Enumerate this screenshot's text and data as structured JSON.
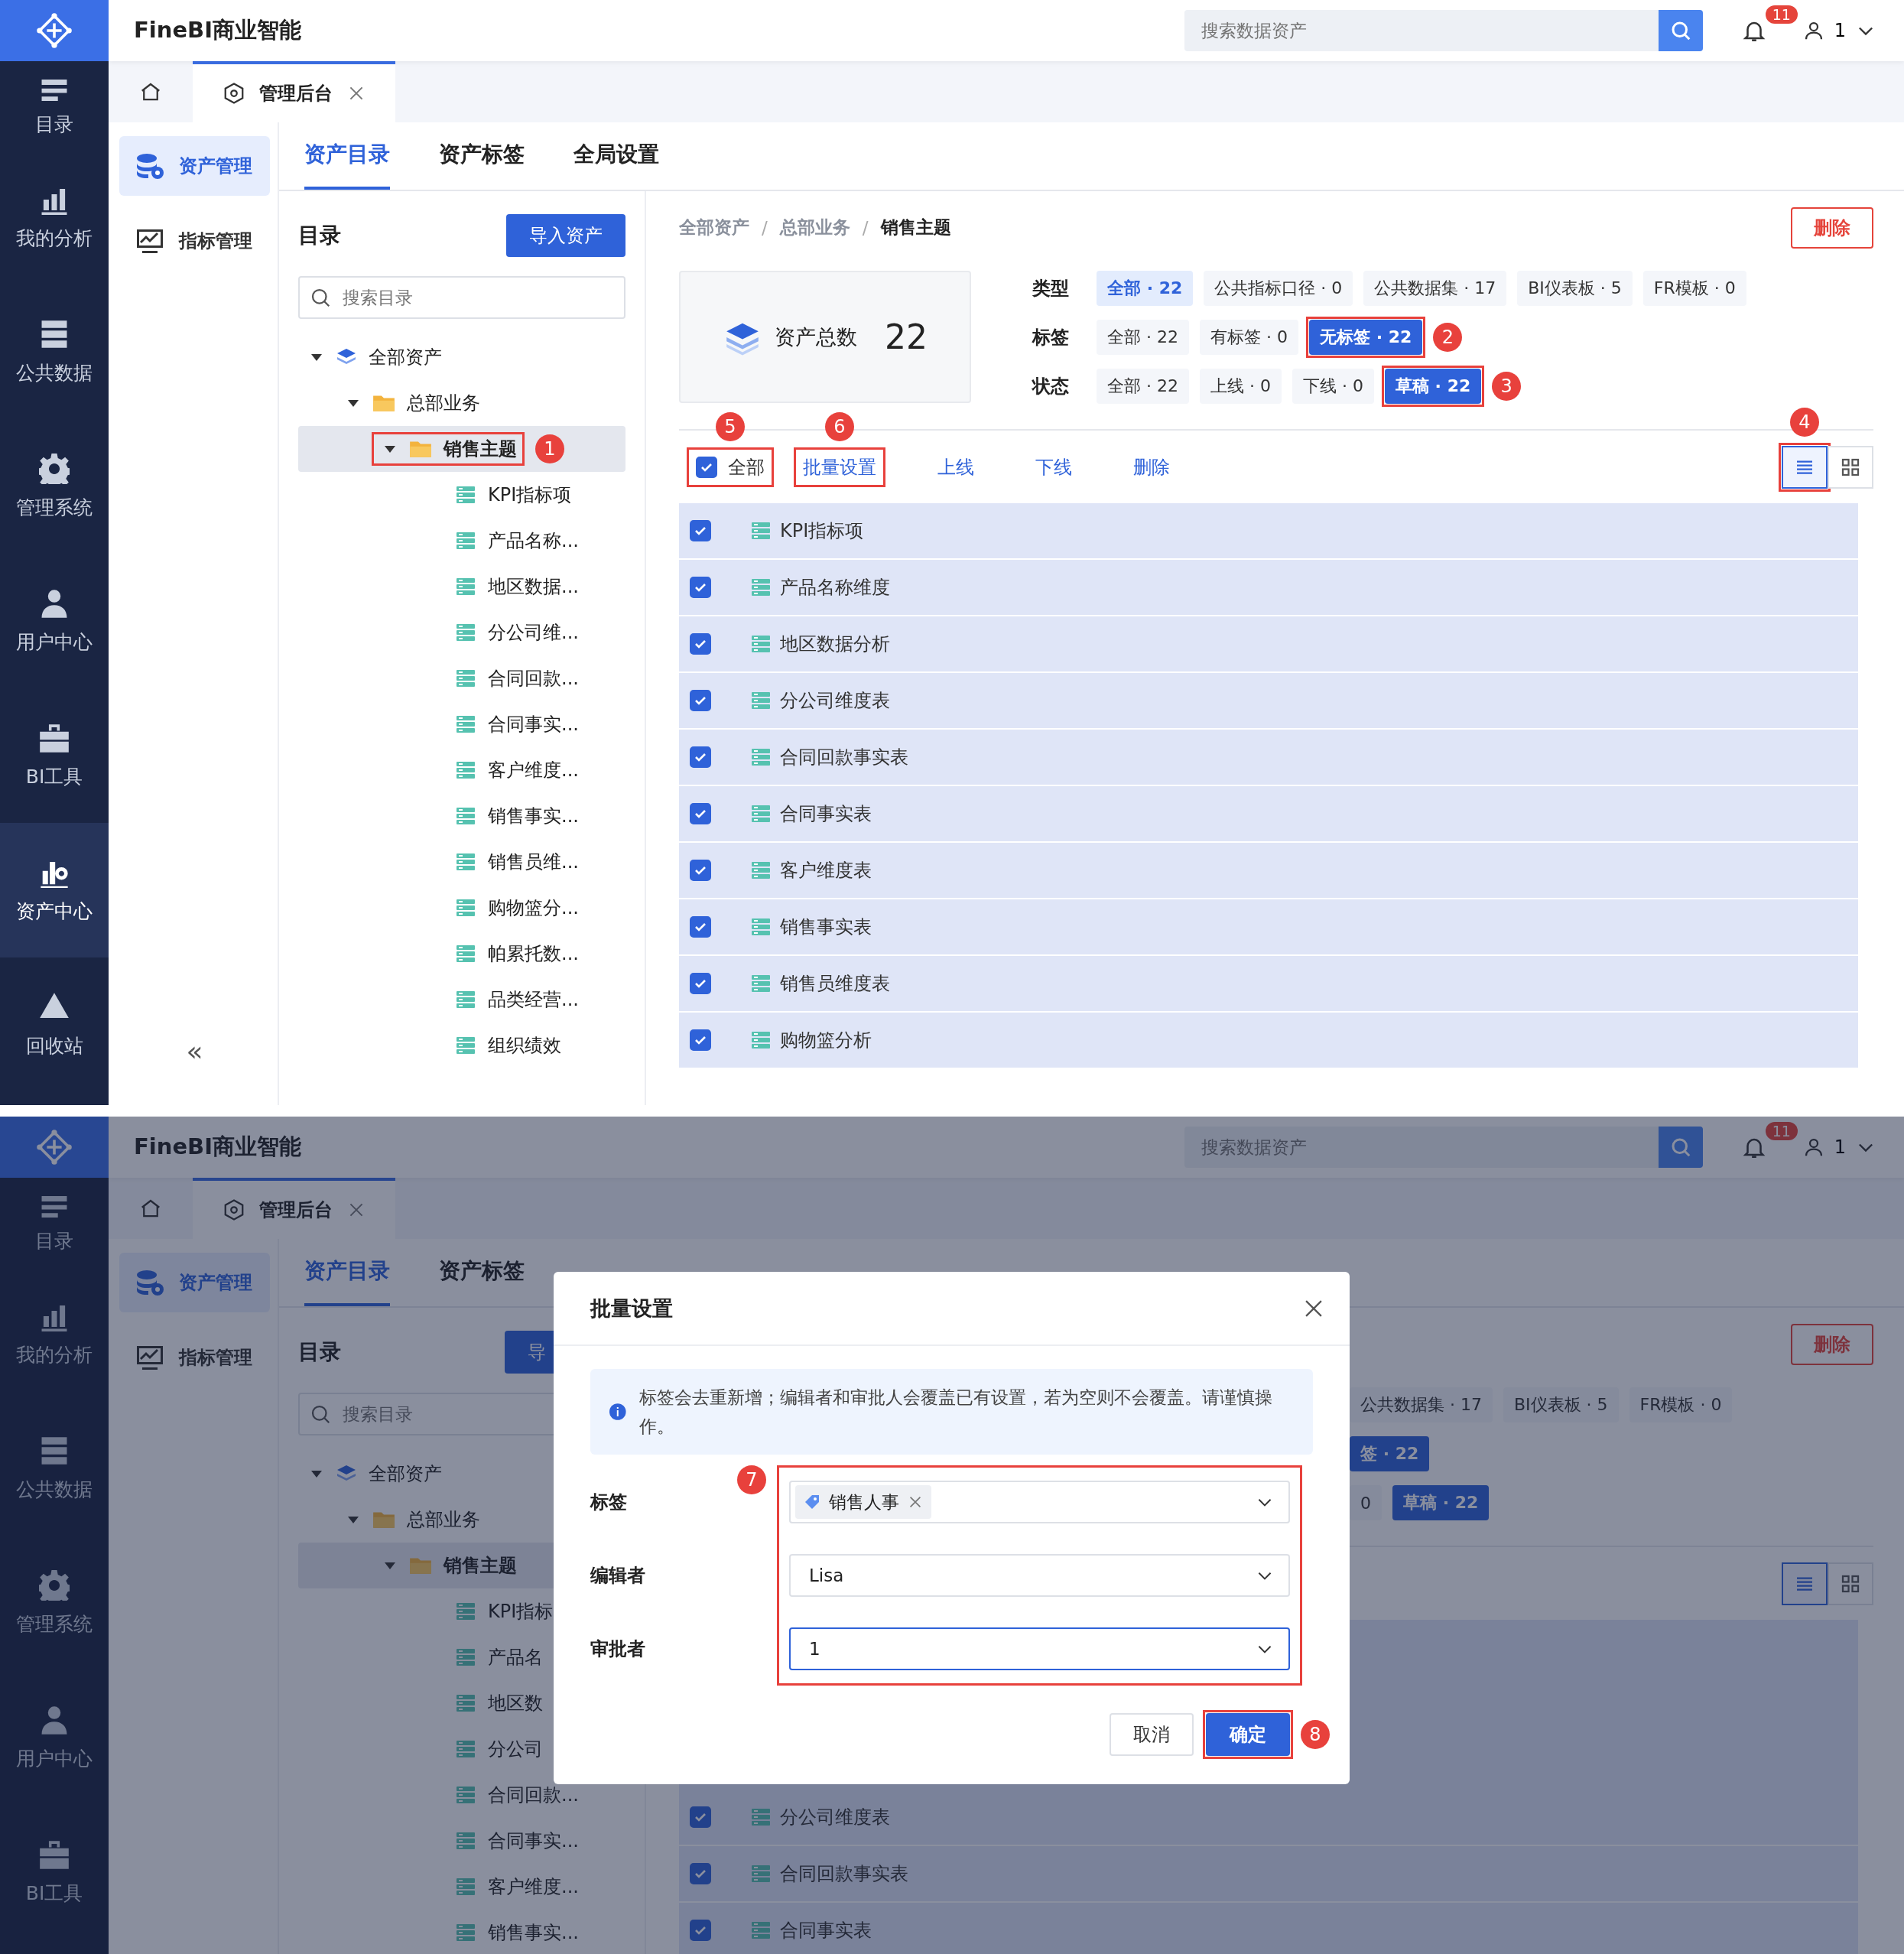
{
  "screens": [
    {
      "app_title": "FineBI商业智能",
      "search": {
        "placeholder": "搜索数据资产"
      },
      "notifications": "11",
      "user": "1",
      "nav": [
        {
          "label": "目录",
          "selected": false
        },
        {
          "label": "我的分析",
          "selected": false
        },
        {
          "label": "公共数据",
          "selected": false
        },
        {
          "label": "管理系统",
          "selected": false
        },
        {
          "label": "用户中心",
          "selected": false
        },
        {
          "label": "BI工具",
          "selected": false
        },
        {
          "label": "资产中心",
          "selected": true
        },
        {
          "label": "回收站",
          "selected": false
        }
      ],
      "page_tab": {
        "label": "管理后台"
      },
      "side_menu": [
        {
          "label": "资产管理",
          "selected": true
        },
        {
          "label": "指标管理",
          "selected": false
        }
      ],
      "collapse": "«",
      "section_tabs": [
        {
          "label": "资产目录",
          "selected": true
        },
        {
          "label": "资产标签",
          "selected": false
        },
        {
          "label": "全局设置",
          "selected": false
        }
      ],
      "tree_panel": {
        "title": "目录",
        "import_button": "导入资产",
        "search_placeholder": "搜索目录",
        "tree": [
          {
            "label": "全部资产",
            "kind": "root",
            "expanded": true,
            "selected": false,
            "children": [
              {
                "label": "总部业务",
                "kind": "folder",
                "expanded": true,
                "selected": false,
                "children": [
                  {
                    "label": "销售主题",
                    "kind": "folder",
                    "expanded": true,
                    "selected": true,
                    "marker": "1",
                    "children": [
                      {
                        "label": "KPI指标项",
                        "kind": "table",
                        "selected": false
                      },
                      {
                        "label": "产品名称...",
                        "kind": "table",
                        "selected": false
                      },
                      {
                        "label": "地区数据...",
                        "kind": "table",
                        "selected": false
                      },
                      {
                        "label": "分公司维...",
                        "kind": "table",
                        "selected": false
                      },
                      {
                        "label": "合同回款...",
                        "kind": "table",
                        "selected": false
                      },
                      {
                        "label": "合同事实...",
                        "kind": "table",
                        "selected": false
                      },
                      {
                        "label": "客户维度...",
                        "kind": "table",
                        "selected": false
                      },
                      {
                        "label": "销售事实...",
                        "kind": "table",
                        "selected": false
                      },
                      {
                        "label": "销售员维...",
                        "kind": "table",
                        "selected": false
                      },
                      {
                        "label": "购物篮分...",
                        "kind": "table",
                        "selected": false
                      },
                      {
                        "label": "帕累托数...",
                        "kind": "table",
                        "selected": false
                      },
                      {
                        "label": "品类经营...",
                        "kind": "table",
                        "selected": false
                      },
                      {
                        "label": "组织绩效",
                        "kind": "table",
                        "selected": false
                      }
                    ]
                  }
                ]
              }
            ]
          }
        ]
      },
      "breadcrumb": [
        {
          "label": "全部资产",
          "kind": "link"
        },
        {
          "label": "/",
          "kind": "separator"
        },
        {
          "label": "总部业务",
          "kind": "link"
        },
        {
          "label": "/",
          "kind": "separator"
        },
        {
          "label": "销售主题",
          "kind": "current"
        }
      ],
      "delete_button": "删除",
      "summary": {
        "label": "资产总数",
        "value": "22"
      },
      "filters": [
        {
          "label": "类型",
          "kind": "light",
          "options": [
            {
              "label": "全部 · 22",
              "selected": true
            },
            {
              "label": "公共指标口径 · 0",
              "selected": false
            },
            {
              "label": "公共数据集 · 17",
              "selected": false
            },
            {
              "label": "BI仪表板 · 5",
              "selected": false
            },
            {
              "label": "FR模板 · 0",
              "selected": false
            }
          ]
        },
        {
          "label": "标签",
          "kind": "solid",
          "options": [
            {
              "label": "全部 · 22",
              "selected": false
            },
            {
              "label": "有标签 · 0",
              "selected": false
            },
            {
              "label": "无标签 · 22",
              "selected": true,
              "marker": "2"
            }
          ]
        },
        {
          "label": "状态",
          "kind": "solid",
          "options": [
            {
              "label": "全部 · 22",
              "selected": false
            },
            {
              "label": "上线 · 0",
              "selected": false
            },
            {
              "label": "下线 · 0",
              "selected": false
            },
            {
              "label": "草稿 · 22",
              "selected": true,
              "marker": "3"
            }
          ]
        }
      ],
      "toolbar": {
        "select_all": {
          "label": "全部",
          "checked": true,
          "marker": "5"
        },
        "actions": [
          {
            "label": "批量设置",
            "marker": "6"
          },
          {
            "label": "上线"
          },
          {
            "label": "下线"
          },
          {
            "label": "删除"
          }
        ],
        "views": [
          {
            "kind": "list",
            "selected": true,
            "marker": "4"
          },
          {
            "kind": "grid",
            "selected": false
          }
        ]
      },
      "rows": [
        {
          "name": "KPI指标项",
          "checked": true
        },
        {
          "name": "产品名称维度",
          "checked": true
        },
        {
          "name": "地区数据分析",
          "checked": true
        },
        {
          "name": "分公司维度表",
          "checked": true
        },
        {
          "name": "合同回款事实表",
          "checked": true
        },
        {
          "name": "合同事实表",
          "checked": true
        },
        {
          "name": "客户维度表",
          "checked": true
        },
        {
          "name": "销售事实表",
          "checked": true
        },
        {
          "name": "销售员维度表",
          "checked": true
        },
        {
          "name": "购物篮分析",
          "checked": true
        }
      ]
    },
    {
      "app_title": "FineBI商业智能",
      "search": {
        "placeholder": "搜索数据资产"
      },
      "notifications": "11",
      "user": "1",
      "nav": [
        {
          "label": "目录",
          "selected": false
        },
        {
          "label": "我的分析",
          "selected": false
        },
        {
          "label": "公共数据",
          "selected": false
        },
        {
          "label": "管理系统",
          "selected": false
        },
        {
          "label": "用户中心",
          "selected": false
        },
        {
          "label": "BI工具",
          "selected": false
        }
      ],
      "page_tab": {
        "label": "管理后台"
      },
      "side_menu": [
        {
          "label": "资产管理",
          "selected": true
        },
        {
          "label": "指标管理",
          "selected": false
        }
      ],
      "section_tabs": [
        {
          "label": "资产目录",
          "selected": true
        },
        {
          "label": "资产标签",
          "selected": false
        }
      ],
      "tree_panel": {
        "title": "目录",
        "import_button": "导",
        "search_placeholder": "搜索目录",
        "tree": [
          {
            "label": "全部资产",
            "kind": "root",
            "expanded": true,
            "selected": false,
            "children": [
              {
                "label": "总部业务",
                "kind": "folder",
                "expanded": true,
                "selected": false,
                "children": [
                  {
                    "label": "销售主题",
                    "kind": "folder",
                    "expanded": true,
                    "selected": true,
                    "children": [
                      {
                        "label": "KPI指标",
                        "kind": "table",
                        "selected": false
                      },
                      {
                        "label": "产品名",
                        "kind": "table",
                        "selected": false
                      },
                      {
                        "label": "地区数",
                        "kind": "table",
                        "selected": false
                      },
                      {
                        "label": "分公司",
                        "kind": "table",
                        "selected": false
                      },
                      {
                        "label": "合同回款...",
                        "kind": "table",
                        "selected": false
                      },
                      {
                        "label": "合同事实...",
                        "kind": "table",
                        "selected": false
                      },
                      {
                        "label": "客户维度...",
                        "kind": "table",
                        "selected": false
                      },
                      {
                        "label": "销售事实...",
                        "kind": "table",
                        "selected": false
                      }
                    ]
                  }
                ]
              }
            ]
          }
        ]
      },
      "delete_button": "删除",
      "filters": [
        {
          "options": [
            {
              "label": "公共数据集 · 17",
              "selected": false
            },
            {
              "label": "BI仪表板 · 5",
              "selected": false
            },
            {
              "label": "FR模板 · 0",
              "selected": false
            }
          ]
        },
        {
          "kind": "solid",
          "options": [
            {
              "label": "签 · 22",
              "selected": true
            }
          ]
        },
        {
          "kind": "solid",
          "options": [
            {
              "label": "0",
              "selected": false
            },
            {
              "label": "草稿 · 22",
              "selected": true
            }
          ]
        }
      ],
      "toolbar": {
        "views": [
          {
            "kind": "list",
            "selected": true
          },
          {
            "kind": "grid",
            "selected": false
          }
        ]
      },
      "rows": [
        {
          "name": "分公司维度表",
          "checked": true
        },
        {
          "name": "合同回款事实表",
          "checked": true
        },
        {
          "name": "合同事实表",
          "checked": true
        }
      ],
      "dialog": {
        "title": "批量设置",
        "notice": "标签会去重新增；编辑者和审批人会覆盖已有设置，若为空则不会覆盖。请谨慎操作。",
        "fields_marker": "7",
        "fields": [
          {
            "label": "标签",
            "kind": "tags",
            "tags": [
              "销售人事"
            ],
            "focused": false
          },
          {
            "label": "编辑者",
            "kind": "select",
            "value": "Lisa",
            "focused": false
          },
          {
            "label": "审批者",
            "kind": "select",
            "value": "1",
            "focused": true
          }
        ],
        "buttons": [
          {
            "label": "取消",
            "kind": "secondary"
          },
          {
            "label": "确定",
            "kind": "primary",
            "marker": "8"
          }
        ]
      }
    }
  ]
}
